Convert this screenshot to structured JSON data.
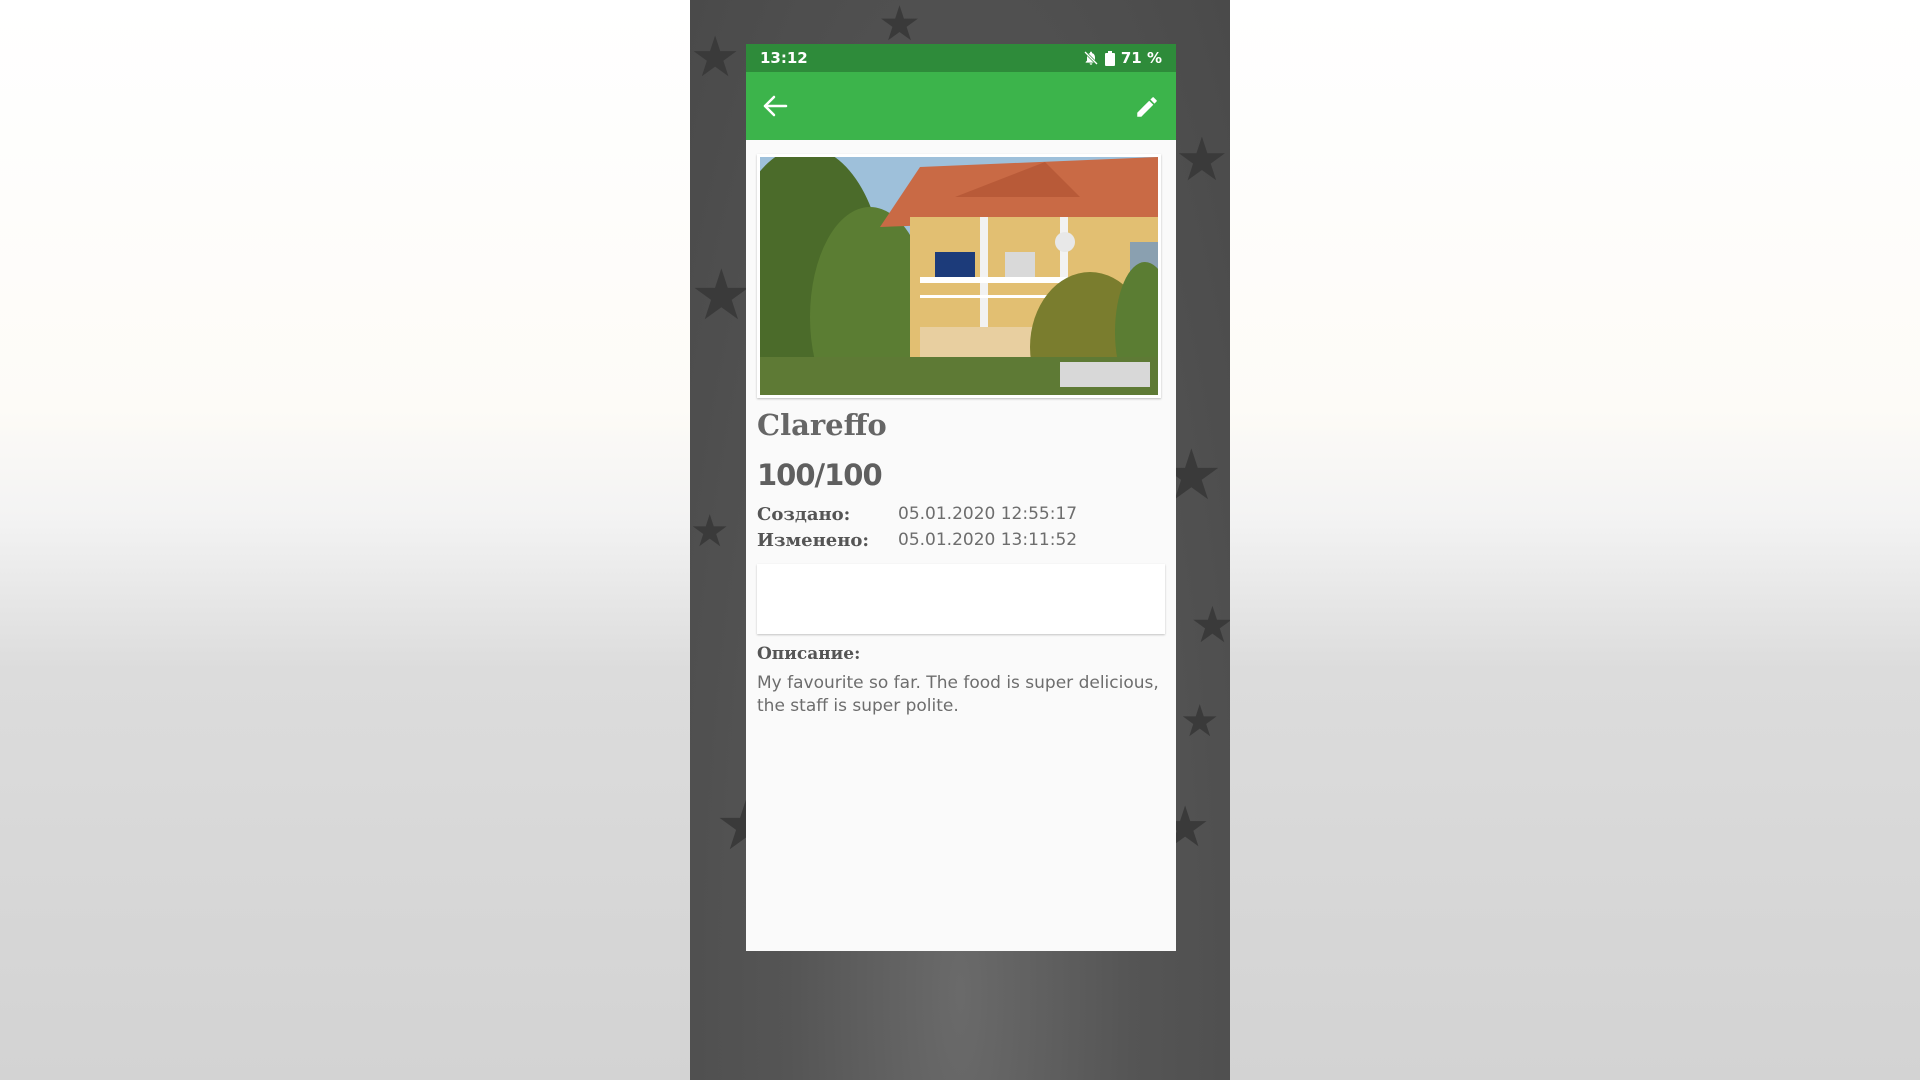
{
  "status_bar": {
    "time": "13:12",
    "battery": "71 %",
    "icons": [
      "bell-off-icon",
      "battery-icon"
    ]
  },
  "app_bar": {
    "color": "#3cb44b",
    "status_color": "#2e8b3a",
    "icons": [
      "back-arrow-icon",
      "edit-pencil-icon"
    ]
  },
  "entry": {
    "title": "Clareffo",
    "score": "100/100",
    "created_label": "Создано:",
    "created_value": "05.01.2020 12:55:17",
    "modified_label": "Изменено:",
    "modified_value": "05.01.2020 13:11:52",
    "description_label": "Описание:",
    "description": "My favourite so far. The food is super delicious, the staff is super polite."
  }
}
